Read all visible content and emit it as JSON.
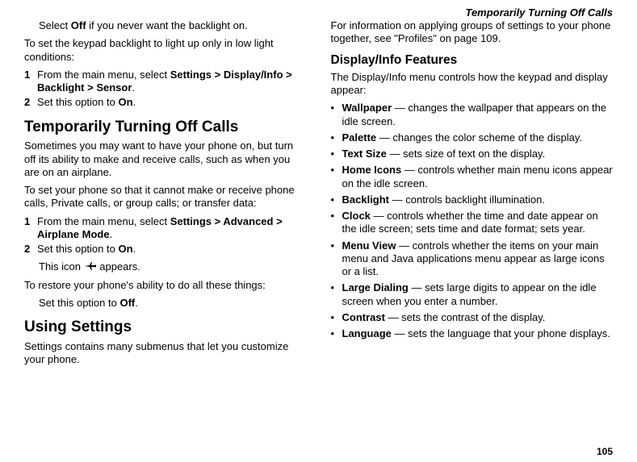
{
  "running_head": "Temporarily Turning Off Calls",
  "page_number": "105",
  "left": {
    "intro_select_off": {
      "pre": "Select ",
      "bold": "Off",
      "post": " if you never want the backlight on."
    },
    "lowlight_intro": "To set the keypad backlight to light up only in low light conditions:",
    "lowlight_steps": [
      {
        "num": "1",
        "pre": "From the main menu, select ",
        "bold": "Settings > Display/Info > Backlight > Sensor",
        "post": "."
      },
      {
        "num": "2",
        "pre": "Set this option to ",
        "bold": "On",
        "post": "."
      }
    ],
    "h_turnoff": "Temporarily Turning Off Calls",
    "turnoff_p1": "Sometimes you may want to have your phone on, but turn off its ability to make and receive calls, such as when you are on an airplane.",
    "turnoff_p2": "To set your phone so that it cannot make or receive phone calls, Private calls, or group calls; or transfer data:",
    "turnoff_steps": [
      {
        "num": "1",
        "pre": "From the main menu, select ",
        "bold": "Settings > Advanced > Airplane Mode",
        "post": "."
      },
      {
        "num": "2",
        "pre": "Set this option to ",
        "bold": "On",
        "post": "."
      }
    ],
    "icon_line": {
      "pre": "This icon ",
      "post": " appears."
    },
    "restore_p": "To restore your phone's ability to do all these things:",
    "restore_step": {
      "pre": "Set this option to ",
      "bold": "Off",
      "post": "."
    },
    "h_using": "Using Settings",
    "using_p": "Settings contains many submenus that let you customize your phone."
  },
  "right": {
    "profiles_p": "For information on applying groups of settings to your phone together, see \"Profiles\" on page 109.",
    "h_displayinfo": "Display/Info Features",
    "displayinfo_p": "The Display/Info menu controls how the keypad and display appear:",
    "features": [
      {
        "term": "Wallpaper",
        "desc": " — changes the wallpaper that appears on the idle screen."
      },
      {
        "term": "Palette",
        "desc": " — changes the color scheme of the display."
      },
      {
        "term": "Text Size",
        "desc": " — sets size of text on the display."
      },
      {
        "term": "Home Icons",
        "desc": " — controls whether main menu icons appear on the idle screen."
      },
      {
        "term": "Backlight",
        "desc": " — controls backlight illumination."
      },
      {
        "term": "Clock",
        "desc": " — controls whether the time and date appear on the idle screen; sets time and date format; sets year."
      },
      {
        "term": "Menu View",
        "desc": " — controls whether the items on your main menu and Java applications menu appear as large icons or a list."
      },
      {
        "term": "Large Dialing",
        "desc": " — sets large digits to appear on the idle screen when you enter a number."
      },
      {
        "term": "Contrast",
        "desc": " — sets the contrast of the display."
      },
      {
        "term": "Language",
        "desc": " — sets the language that your phone displays."
      }
    ]
  }
}
